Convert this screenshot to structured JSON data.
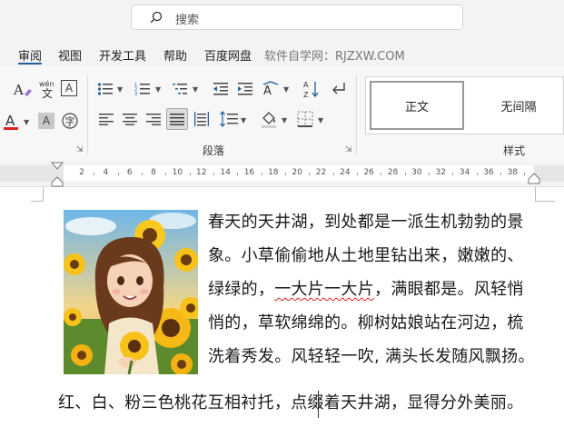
{
  "search": {
    "placeholder": "搜索"
  },
  "menu": {
    "tabs": [
      {
        "label": "审阅"
      },
      {
        "label": "视图"
      },
      {
        "label": "开发工具"
      },
      {
        "label": "帮助"
      },
      {
        "label": "百度网盘"
      },
      {
        "label": "软件自学网：RJZXW.COM"
      }
    ]
  },
  "ribbon": {
    "paragraph_group_label": "段落",
    "styles_group_label": "样式",
    "font_icons": {
      "phonetic": "wén",
      "highlight_label": "A",
      "shade_label": "A"
    },
    "styles": [
      {
        "label": "正文"
      },
      {
        "label": "无间隔"
      }
    ]
  },
  "ruler": {
    "numbers": [
      "2",
      "4",
      "6",
      "8",
      "10",
      "12",
      "14",
      "16",
      "18",
      "20",
      "22",
      "24",
      "26",
      "28",
      "30",
      "32",
      "34",
      "36",
      "38"
    ]
  },
  "document": {
    "lines": [
      {
        "text": "春天的天井湖，到处都是一派生机勃勃的景"
      },
      {
        "text": "象。小草偷偷地从土地里钻出来，嫩嫩的、"
      },
      {
        "pre": "绿绿的，",
        "marked": "一大片一大片",
        "post": "，满眼都是。风轻悄"
      },
      {
        "text": "悄的，草软绵绵的。柳树姑娘站在河边，梳"
      },
      {
        "text": "洗着秀发。风轻轻一吹, 满头长发随风飘扬。"
      },
      {
        "text": "红、白、粉三色桃花互相衬托，点缀着天井湖，显得分外美丽。"
      }
    ]
  },
  "colors": {
    "accent": "#1f5f9e",
    "font_color_red": "#e02020",
    "spell_error": "#e02020"
  }
}
